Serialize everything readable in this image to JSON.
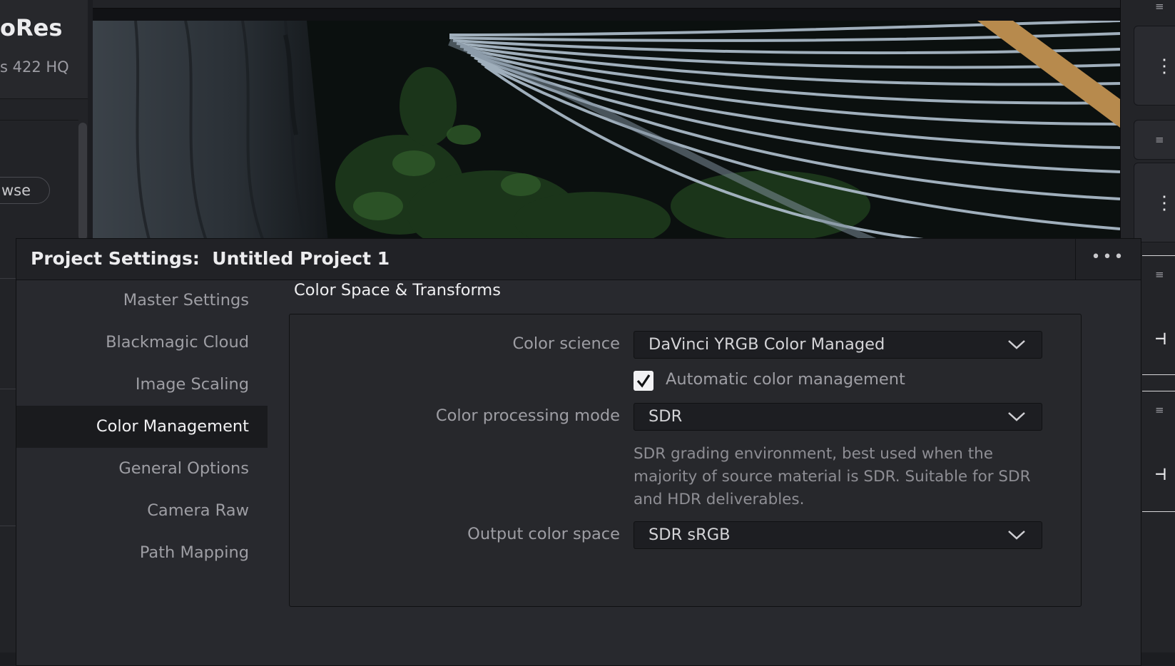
{
  "background": {
    "codec_title": "oRes",
    "codec_subtitle": "s 422 HQ",
    "browse_label": "wse"
  },
  "dialog": {
    "title_prefix": "Project Settings:",
    "project_name": "Untitled Project 1",
    "options_label": "•••"
  },
  "nav": {
    "items": [
      {
        "label": "Master Settings",
        "active": false
      },
      {
        "label": "Blackmagic Cloud",
        "active": false
      },
      {
        "label": "Image Scaling",
        "active": false
      },
      {
        "label": "Color Management",
        "active": true
      },
      {
        "label": "General Options",
        "active": false
      },
      {
        "label": "Camera Raw",
        "active": false
      },
      {
        "label": "Path Mapping",
        "active": false
      }
    ]
  },
  "section": {
    "title": "Color Space & Transforms",
    "color_science": {
      "label": "Color science",
      "value": "DaVinci YRGB Color Managed"
    },
    "auto_color_management": {
      "label": "Automatic color management",
      "checked": true
    },
    "color_processing_mode": {
      "label": "Color processing mode",
      "value": "SDR"
    },
    "hint": "SDR grading environment, best used when the majority of source material is SDR. Suitable for SDR and HDR deliverables.",
    "output_color_space": {
      "label": "Output color space",
      "value": "SDR sRGB"
    }
  },
  "icons": {
    "options": "more-horizontal-icon",
    "dropdown": "chevron-down-icon",
    "check": "checkmark-icon",
    "rail": [
      "menu-icon",
      "clip-icon",
      "split-icon"
    ]
  },
  "colors": {
    "dialog_bg": "#28292e",
    "header_bg": "#212226",
    "active_nav_bg": "#1a1b1e",
    "field_bg": "#1d1e22",
    "accent_text": "#ececee"
  }
}
